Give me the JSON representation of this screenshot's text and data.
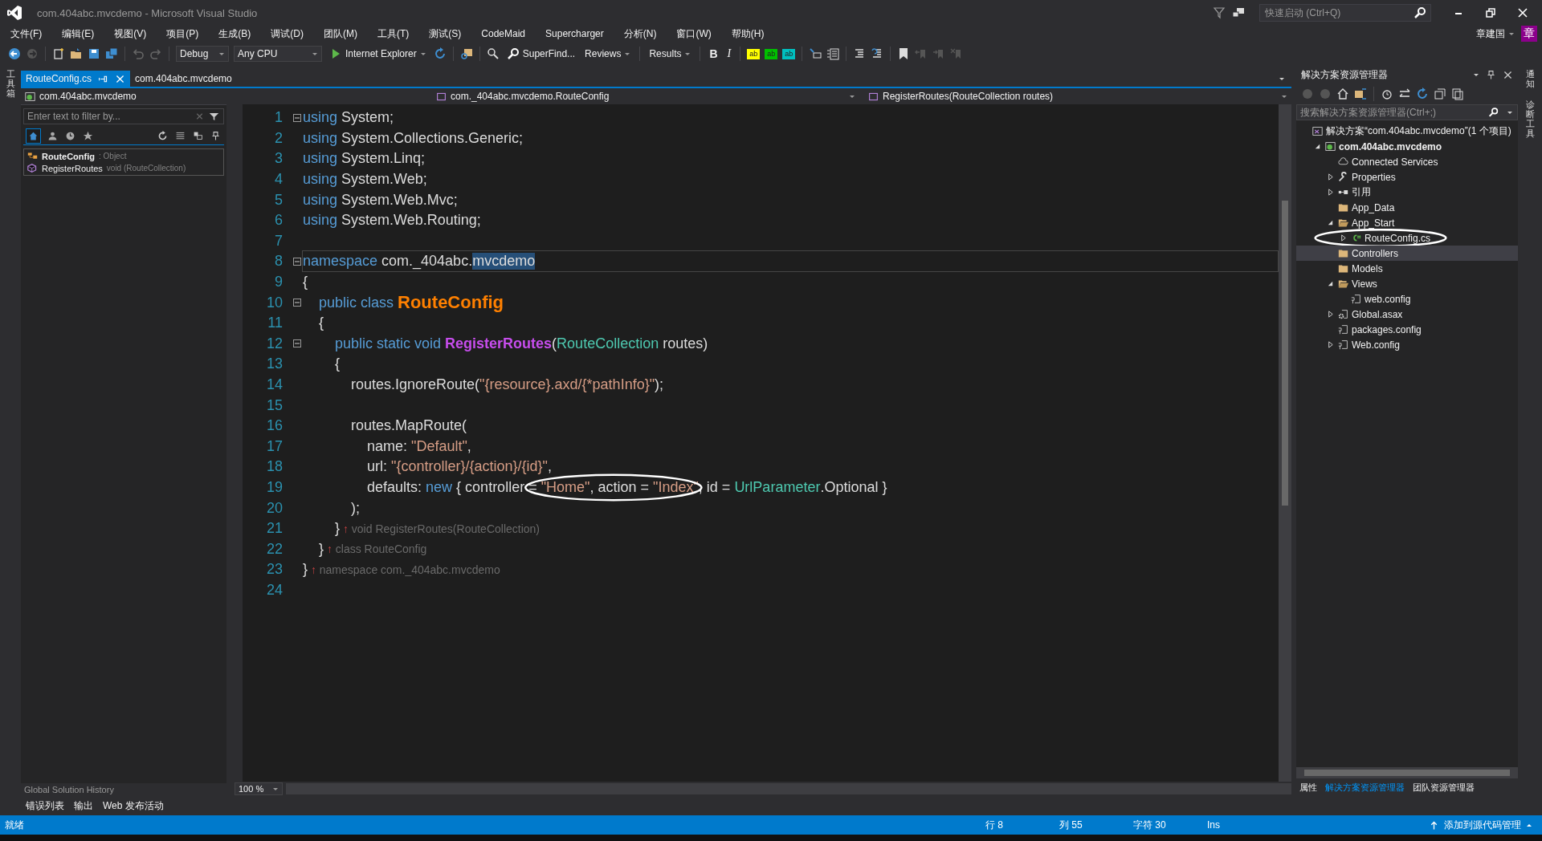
{
  "window": {
    "title": "com.404abc.mvcdemo - Microsoft Visual Studio",
    "quick_launch": {
      "placeholder": "快速启动 (Ctrl+Q)"
    },
    "user": "章建国",
    "avatar": "章"
  },
  "menu": [
    "文件(F)",
    "编辑(E)",
    "视图(V)",
    "项目(P)",
    "生成(B)",
    "调试(D)",
    "团队(M)",
    "工具(T)",
    "测试(S)",
    "CodeMaid",
    "Supercharger",
    "分析(N)",
    "窗口(W)",
    "帮助(H)"
  ],
  "toolbar": {
    "configuration": "Debug",
    "platform": "Any CPU",
    "run_target": "Internet Explorer",
    "superfind": "SuperFind...",
    "reviews": "Reviews",
    "results": "Results",
    "bold": "B",
    "italic": "I",
    "highlights": [
      {
        "label": "ab",
        "color": "#ffff00"
      },
      {
        "label": "ab",
        "color": "#00c000"
      },
      {
        "label": "ab",
        "color": "#00c0c0"
      }
    ]
  },
  "left_strip": [
    "工具箱"
  ],
  "right_strip": [
    "通知",
    "诊断工具"
  ],
  "tabs": [
    {
      "label": "RouteConfig.cs",
      "selected": true
    },
    {
      "label": "com.404abc.mvcdemo",
      "selected": false
    }
  ],
  "class_view": {
    "project": "com.404abc.mvcdemo",
    "filter": {
      "placeholder": "Enter text to filter by..."
    },
    "members": [
      {
        "name": "RouteConfig",
        "detail": ": Object",
        "kind": "class"
      },
      {
        "name": "RegisterRoutes",
        "detail": "void (RouteCollection)",
        "kind": "method"
      }
    ],
    "footer": "Global Solution History"
  },
  "editor": {
    "nav": [
      "com._404abc.mvcdemo.RouteConfig",
      "RegisterRoutes(RouteCollection routes)"
    ],
    "zoom": "100 %",
    "lines": [
      {
        "number": "1",
        "fold": true,
        "current": false,
        "tokens": [
          {
            "kind": "keyword",
            "text": "using"
          },
          {
            "kind": "plain",
            "text": " System;"
          }
        ]
      },
      {
        "number": "2",
        "fold": false,
        "current": false,
        "tokens": [
          {
            "kind": "keyword",
            "text": "using"
          },
          {
            "kind": "plain",
            "text": " System.Collections.Generic;"
          }
        ]
      },
      {
        "number": "3",
        "fold": false,
        "current": false,
        "tokens": [
          {
            "kind": "keyword",
            "text": "using"
          },
          {
            "kind": "plain",
            "text": " System.Linq;"
          }
        ]
      },
      {
        "number": "4",
        "fold": false,
        "current": false,
        "tokens": [
          {
            "kind": "keyword",
            "text": "using"
          },
          {
            "kind": "plain",
            "text": " System.Web;"
          }
        ]
      },
      {
        "number": "5",
        "fold": false,
        "current": false,
        "tokens": [
          {
            "kind": "keyword",
            "text": "using"
          },
          {
            "kind": "plain",
            "text": " System.Web.Mvc;"
          }
        ]
      },
      {
        "number": "6",
        "fold": false,
        "current": false,
        "tokens": [
          {
            "kind": "keyword",
            "text": "using"
          },
          {
            "kind": "plain",
            "text": " System.Web.Routing;"
          }
        ]
      },
      {
        "number": "7",
        "fold": false,
        "current": false
      },
      {
        "number": "8",
        "fold": true,
        "current": true,
        "tokens": [
          {
            "kind": "keyword",
            "text": "namespace"
          },
          {
            "kind": "plain",
            "text": " com._404abc."
          },
          {
            "kind": "selected-text",
            "text": "mvcdemo"
          }
        ]
      },
      {
        "number": "9",
        "fold": false,
        "current": false,
        "tokens": [
          {
            "kind": "plain",
            "text": "{"
          }
        ]
      },
      {
        "number": "10",
        "fold": true,
        "current": false,
        "tokens": [
          {
            "kind": "keyword",
            "text": "    public class "
          },
          {
            "kind": "class-name",
            "text": "RouteConfig"
          }
        ]
      },
      {
        "number": "11",
        "fold": false,
        "current": false,
        "tokens": [
          {
            "kind": "plain",
            "text": "    {"
          }
        ]
      },
      {
        "number": "12",
        "fold": true,
        "current": false,
        "tokens": [
          {
            "kind": "keyword",
            "text": "        public static void "
          },
          {
            "kind": "method-name",
            "text": "RegisterRoutes"
          },
          {
            "kind": "plain",
            "text": "("
          },
          {
            "kind": "type",
            "text": "RouteCollection"
          },
          {
            "kind": "plain",
            "text": " routes)"
          }
        ]
      },
      {
        "number": "13",
        "fold": false,
        "current": false,
        "tokens": [
          {
            "kind": "plain",
            "text": "        {"
          }
        ]
      },
      {
        "number": "14",
        "fold": false,
        "current": false,
        "tokens": [
          {
            "kind": "plain",
            "text": "            routes.IgnoreRoute("
          },
          {
            "kind": "string",
            "text": "\"{resource}.axd/{*pathInfo}\""
          },
          {
            "kind": "plain",
            "text": ");"
          }
        ]
      },
      {
        "number": "15",
        "fold": false,
        "current": false
      },
      {
        "number": "16",
        "fold": false,
        "current": false,
        "tokens": [
          {
            "kind": "plain",
            "text": "            routes.MapRoute("
          }
        ]
      },
      {
        "number": "17",
        "fold": false,
        "current": false,
        "tokens": [
          {
            "kind": "plain",
            "text": "                name: "
          },
          {
            "kind": "string",
            "text": "\"Default\""
          },
          {
            "kind": "plain",
            "text": ","
          }
        ]
      },
      {
        "number": "18",
        "fold": false,
        "current": false,
        "tokens": [
          {
            "kind": "plain",
            "text": "                url: "
          },
          {
            "kind": "string",
            "text": "\"{controller}/{action}/{id}\""
          },
          {
            "kind": "plain",
            "text": ","
          }
        ]
      },
      {
        "number": "19",
        "fold": false,
        "current": false,
        "tokens": [
          {
            "kind": "plain",
            "text": "                defaults: "
          },
          {
            "kind": "keyword",
            "text": "new"
          },
          {
            "kind": "plain",
            "text": " { controller"
          },
          {
            "kind": "group",
            "circled": true,
            "tokens": [
              {
                "kind": "plain",
                "text": " = "
              },
              {
                "kind": "string",
                "text": "\"Home\""
              },
              {
                "kind": "plain",
                "text": ", action = "
              },
              {
                "kind": "string",
                "text": "\"Index\""
              },
              {
                "kind": "plain",
                "text": ","
              }
            ]
          },
          {
            "kind": "plain",
            "text": " id = "
          },
          {
            "kind": "type",
            "text": "UrlParameter"
          },
          {
            "kind": "plain",
            "text": ".Optional }"
          }
        ]
      },
      {
        "number": "20",
        "fold": false,
        "current": false,
        "tokens": [
          {
            "kind": "plain",
            "text": "            );"
          }
        ]
      },
      {
        "number": "21",
        "fold": false,
        "current": false,
        "tokens": [
          {
            "kind": "plain",
            "text": "        }"
          },
          {
            "kind": "hint-arrow",
            "text": " ↑ "
          },
          {
            "kind": "hint",
            "text": "void RegisterRoutes(RouteCollection)"
          }
        ]
      },
      {
        "number": "22",
        "fold": false,
        "current": false,
        "tokens": [
          {
            "kind": "plain",
            "text": "    }"
          },
          {
            "kind": "hint-arrow",
            "text": " ↑ "
          },
          {
            "kind": "hint",
            "text": "class RouteConfig"
          }
        ]
      },
      {
        "number": "23",
        "fold": false,
        "current": false,
        "tokens": [
          {
            "kind": "plain",
            "text": "}"
          },
          {
            "kind": "hint-arrow",
            "text": " ↑ "
          },
          {
            "kind": "hint",
            "text": "namespace com._404abc.mvcdemo"
          }
        ]
      },
      {
        "number": "24",
        "fold": false,
        "current": false
      }
    ]
  },
  "solution_explorer": {
    "title": "解决方案资源管理器",
    "search": {
      "placeholder": "搜索解决方案资源管理器(Ctrl+;)"
    },
    "tree": [
      {
        "label": "解决方案“com.404abc.mvcdemo”(1 个项目)",
        "kind": "solution",
        "selected": false,
        "circled": false,
        "children": [
          {
            "label": "com.404abc.mvcdemo",
            "kind": "project",
            "expanded": true,
            "selected": false,
            "circled": false,
            "children": [
              {
                "label": "Connected Services",
                "kind": "services",
                "selected": false,
                "circled": false
              },
              {
                "label": "Properties",
                "kind": "wrench",
                "expanded": false,
                "selected": false,
                "circled": false
              },
              {
                "label": "引用",
                "kind": "reference",
                "expanded": false,
                "selected": false,
                "circled": false
              },
              {
                "label": "App_Data",
                "kind": "folder",
                "selected": false,
                "circled": false
              },
              {
                "label": "App_Start",
                "kind": "folder-open",
                "expanded": true,
                "selected": false,
                "circled": false,
                "children": [
                  {
                    "label": "RouteConfig.cs",
                    "kind": "csharp",
                    "expanded": false,
                    "selected": false,
                    "circled": true
                  }
                ]
              },
              {
                "label": "Controllers",
                "kind": "folder",
                "selected": true,
                "circled": false
              },
              {
                "label": "Models",
                "kind": "folder",
                "selected": false,
                "circled": false
              },
              {
                "label": "Views",
                "kind": "folder-open",
                "expanded": true,
                "selected": false,
                "circled": false,
                "children": [
                  {
                    "label": "web.config",
                    "kind": "config",
                    "selected": false,
                    "circled": false
                  }
                ]
              },
              {
                "label": "Global.asax",
                "kind": "gear",
                "expanded": false,
                "selected": false,
                "circled": false
              },
              {
                "label": "packages.config",
                "kind": "config",
                "selected": false,
                "circled": false
              },
              {
                "label": "Web.config",
                "kind": "config",
                "expanded": false,
                "selected": false,
                "circled": false
              }
            ]
          }
        ]
      }
    ],
    "bottom_tabs": [
      {
        "label": "属性",
        "selected": false
      },
      {
        "label": "解决方案资源管理器",
        "selected": true
      },
      {
        "label": "团队资源管理器",
        "selected": false
      }
    ]
  },
  "output_tabs": [
    "错误列表",
    "输出",
    "Web 发布活动"
  ],
  "status_bar": {
    "message": "就绪",
    "line": "行 8",
    "column": "列 55",
    "char": "字符 30",
    "mode": "Ins",
    "source_control": "添加到源代码管理"
  }
}
